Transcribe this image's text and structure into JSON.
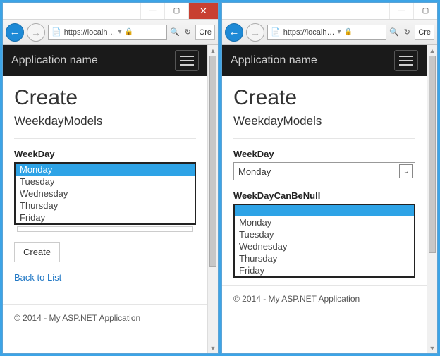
{
  "browser": {
    "url_display": "https://localh…",
    "tab_title": "Cre"
  },
  "left": {
    "app_name": "Application name",
    "page_title": "Create",
    "subtitle": "WeekdayModels",
    "field_label": "WeekDay",
    "options": [
      "Monday",
      "Tuesday",
      "Wednesday",
      "Thursday",
      "Friday"
    ],
    "selected_index": 0,
    "submit_label": "Create",
    "back_link": "Back to List",
    "footer": "© 2014 - My ASP.NET Application"
  },
  "right": {
    "app_name": "Application name",
    "page_title": "Create",
    "subtitle": "WeekdayModels",
    "field1_label": "WeekDay",
    "field1_value": "Monday",
    "field2_label": "WeekDayCanBeNull",
    "options": [
      "Monday",
      "Tuesday",
      "Wednesday",
      "Thursday",
      "Friday"
    ],
    "selected_blank": true,
    "footer": "© 2014 - My ASP.NET Application"
  }
}
